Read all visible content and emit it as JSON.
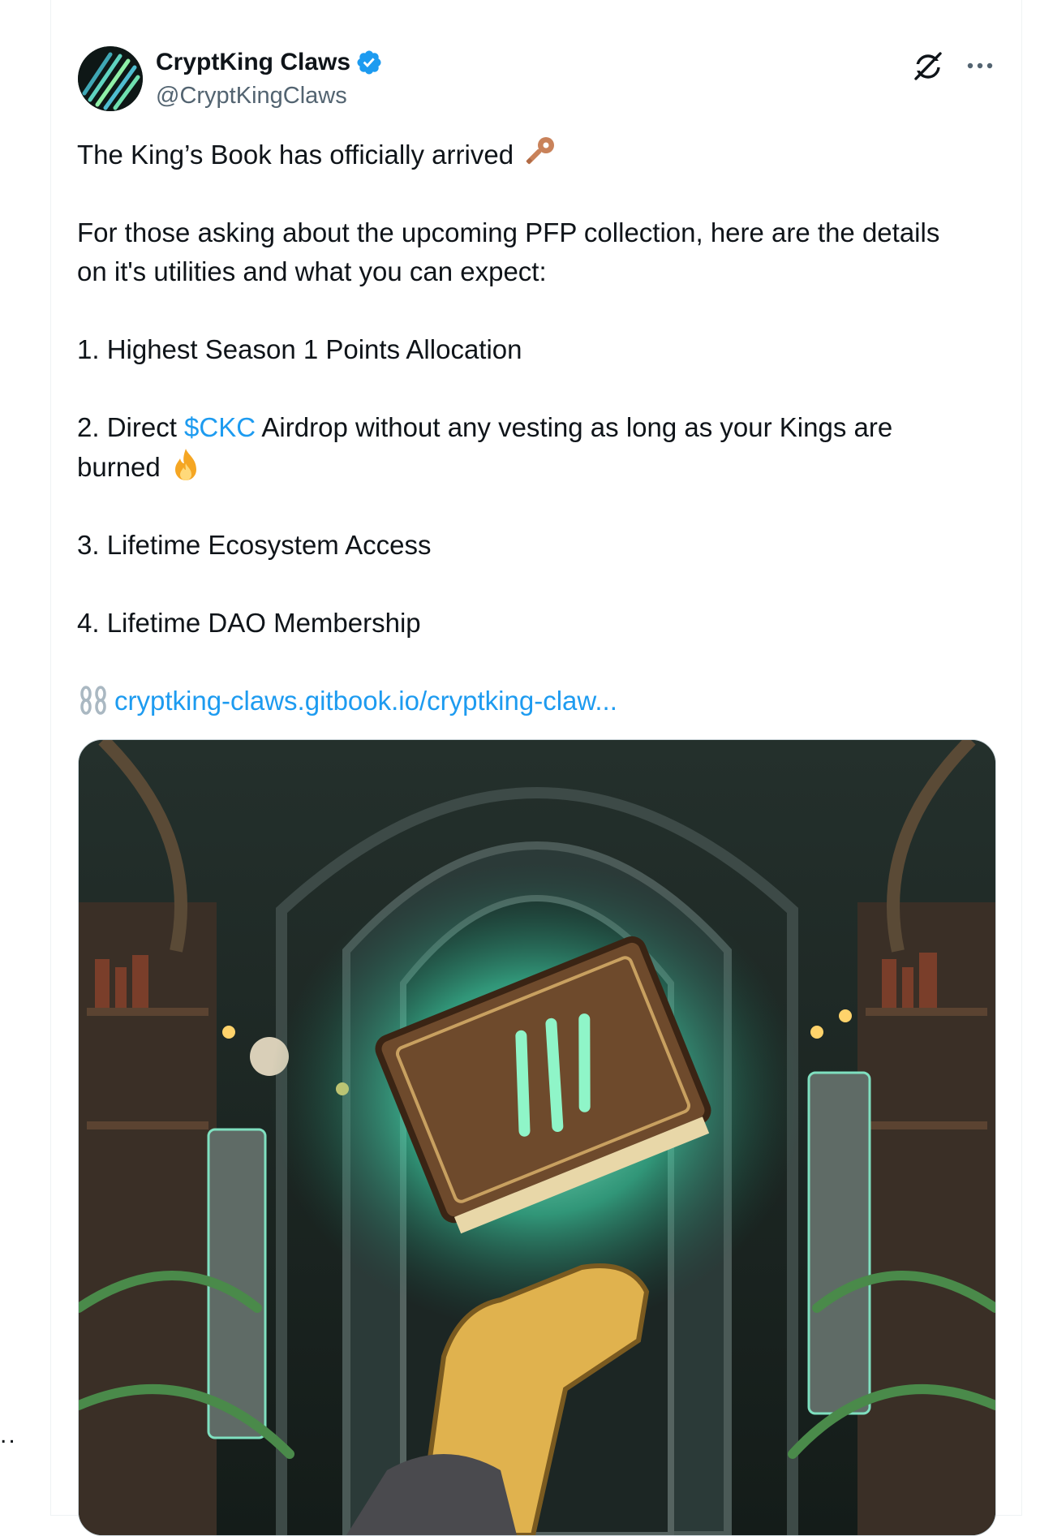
{
  "post": {
    "author_name": "CryptKing Claws",
    "author_handle": "@CryptKingClaws",
    "avatar_icon": "claw-stripes-avatar",
    "verified_icon": "verified-badge-icon",
    "accent_color": "#1d9bf0",
    "lines": {
      "l1": "The King’s Book has officially arrived",
      "l2a": "For those asking about the upcoming PFP collection, here are the details",
      "l2b": "on it's utilities and what you can expect:",
      "l3": "1. Highest Season 1 Points Allocation",
      "l4_pre": "2. Direct ",
      "l4_link": "$CKC",
      "l4_post": " Airdrop without any vesting as long as your Kings are",
      "l4b": "burned",
      "l5": "3. Lifetime Ecosystem Access",
      "l6": "4. Lifetime DAO Membership",
      "url": "cryptking-claws.gitbook.io/cryptking-claw..."
    },
    "media": {
      "alt_icon": "glowing-book-illustration"
    }
  },
  "left_edge_text": ".."
}
